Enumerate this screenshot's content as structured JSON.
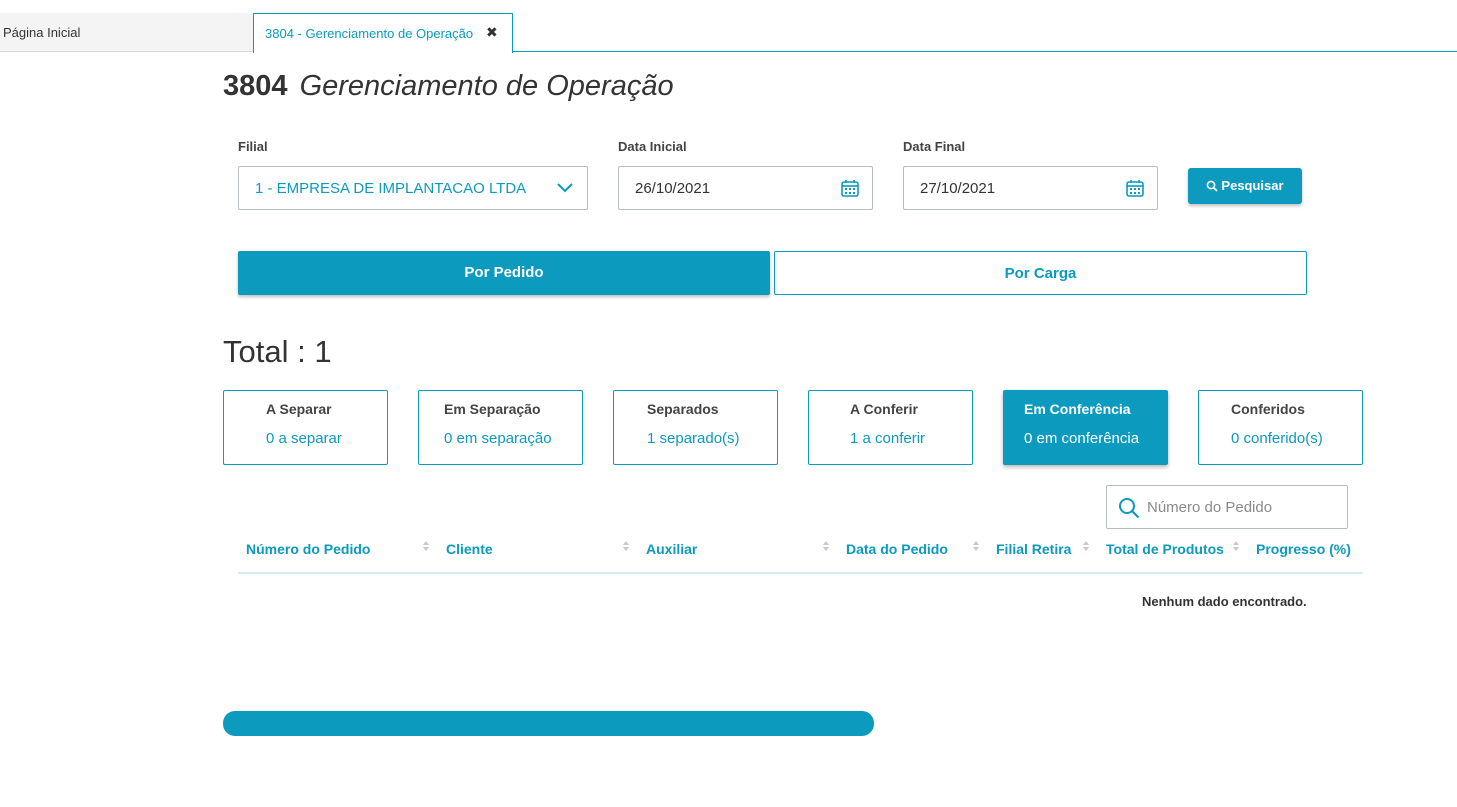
{
  "tabs": {
    "home": "Página Inicial",
    "active": "3804 - Gerenciamento de Operação",
    "close_icon": "close-icon"
  },
  "page": {
    "code": "3804",
    "name": "Gerenciamento de Operação"
  },
  "filters": {
    "filial_label": "Filial",
    "filial_value": "1 - EMPRESA DE IMPLANTACAO LTDA",
    "data_inicial_label": "Data Inicial",
    "data_inicial_value": "26/10/2021",
    "data_final_label": "Data Final",
    "data_final_value": "27/10/2021",
    "search_button": "Pesquisar"
  },
  "view_toggle": {
    "por_pedido": "Por Pedido",
    "por_carga": "Por Carga",
    "selected": "Por Pedido"
  },
  "total_label": "Total : 1",
  "status_cards": [
    {
      "title": "A Separar",
      "value": "0 a separar",
      "active": false
    },
    {
      "title": "Em Separação",
      "value": "0 em separação",
      "active": false
    },
    {
      "title": "Separados",
      "value": "1 separado(s)",
      "active": false
    },
    {
      "title": "A Conferir",
      "value": "1 a conferir",
      "active": false
    },
    {
      "title": "Em Conferência",
      "value": "0 em conferência",
      "active": true
    },
    {
      "title": "Conferidos",
      "value": "0 conferido(s)",
      "active": false
    }
  ],
  "table": {
    "search_placeholder": "Número do Pedido",
    "columns": [
      "Número do Pedido",
      "Cliente",
      "Auxiliar",
      "Data do Pedido",
      "Filial Retira",
      "Total de Produtos",
      "Progresso (%)"
    ],
    "empty_message": "Nenhum dado encontrado."
  },
  "colors": {
    "accent": "#0c9abe",
    "text": "#333333",
    "border": "#b6bcc0"
  }
}
